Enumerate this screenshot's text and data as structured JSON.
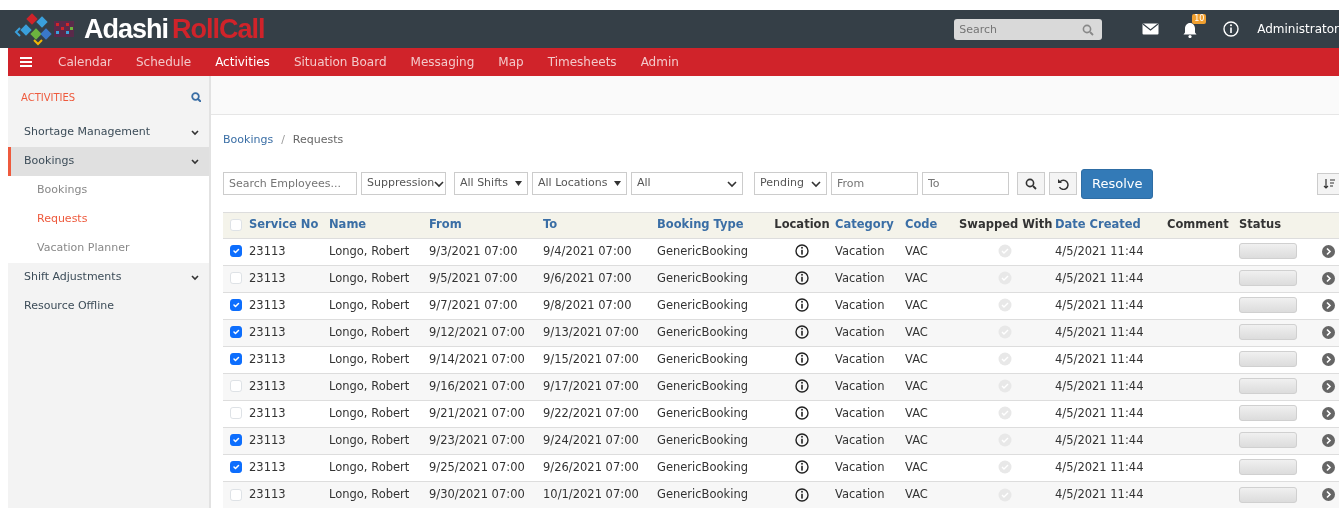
{
  "header": {
    "brand_first": "Adashi",
    "brand_second": "RollCall",
    "search": {
      "placeholder": "Search"
    },
    "notification_count": "10",
    "user": "Administrator"
  },
  "nav": [
    {
      "label": "Calendar",
      "selected": false
    },
    {
      "label": "Schedule",
      "selected": false
    },
    {
      "label": "Activities",
      "selected": true
    },
    {
      "label": "Situation Board",
      "selected": false
    },
    {
      "label": "Messaging",
      "selected": false
    },
    {
      "label": "Map",
      "selected": false
    },
    {
      "label": "Timesheets",
      "selected": false
    },
    {
      "label": "Admin",
      "selected": false
    }
  ],
  "sidebar": {
    "title": "ACTIVITIES",
    "items": [
      {
        "label": "Shortage Management",
        "selected": false,
        "kind": "group"
      },
      {
        "label": "Bookings",
        "selected": true,
        "kind": "group",
        "expanded": true,
        "children": [
          {
            "label": "Bookings",
            "selected": false
          },
          {
            "label": "Requests",
            "selected": true
          },
          {
            "label": "Vacation Planner",
            "selected": false
          }
        ]
      },
      {
        "label": "Shift Adjustments",
        "selected": false,
        "kind": "group"
      },
      {
        "label": "Resource Offline",
        "selected": false,
        "kind": "link"
      }
    ]
  },
  "breadcrumb": {
    "separator": "/",
    "items": [
      {
        "label": "Bookings",
        "kind": "link"
      },
      {
        "label": "Requests",
        "kind": "current"
      }
    ]
  },
  "filters": {
    "employee_search": {
      "placeholder": "Search Employees..."
    },
    "selects": [
      {
        "value": "Suppression",
        "kind": "chevron"
      },
      {
        "value": "All Shifts",
        "kind": "triangle"
      },
      {
        "value": "All Locations",
        "kind": "triangle"
      },
      {
        "value": "All",
        "kind": "chevron"
      },
      {
        "value": "Pending",
        "kind": "chevron"
      }
    ],
    "from": {
      "placeholder": "From"
    },
    "to": {
      "placeholder": "To"
    },
    "resolve_button": "Resolve"
  },
  "table": {
    "select_all": false,
    "columns": [
      {
        "label": "Service No",
        "sortable": true
      },
      {
        "label": "Name",
        "sortable": true
      },
      {
        "label": "From",
        "sortable": true
      },
      {
        "label": "To",
        "sortable": true
      },
      {
        "label": "Booking Type",
        "sortable": true
      },
      {
        "label": "Location",
        "sortable": false
      },
      {
        "label": "Category",
        "sortable": true
      },
      {
        "label": "Code",
        "sortable": true
      },
      {
        "label": "Swapped With",
        "sortable": false
      },
      {
        "label": "Date Created",
        "sortable": true
      },
      {
        "label": "Comment",
        "sortable": false
      },
      {
        "label": "Status",
        "sortable": false
      }
    ],
    "rows": [
      {
        "checked": true,
        "service_no": "23113",
        "name": "Longo, Robert",
        "from": "9/3/2021 07:00",
        "to": "9/4/2021 07:00",
        "booking_type": "GenericBooking",
        "category": "Vacation",
        "code": "VAC",
        "date_created": "4/5/2021 11:44"
      },
      {
        "checked": false,
        "service_no": "23113",
        "name": "Longo, Robert",
        "from": "9/5/2021 07:00",
        "to": "9/6/2021 07:00",
        "booking_type": "GenericBooking",
        "category": "Vacation",
        "code": "VAC",
        "date_created": "4/5/2021 11:44"
      },
      {
        "checked": true,
        "service_no": "23113",
        "name": "Longo, Robert",
        "from": "9/7/2021 07:00",
        "to": "9/8/2021 07:00",
        "booking_type": "GenericBooking",
        "category": "Vacation",
        "code": "VAC",
        "date_created": "4/5/2021 11:44"
      },
      {
        "checked": true,
        "service_no": "23113",
        "name": "Longo, Robert",
        "from": "9/12/2021 07:00",
        "to": "9/13/2021 07:00",
        "booking_type": "GenericBooking",
        "category": "Vacation",
        "code": "VAC",
        "date_created": "4/5/2021 11:44"
      },
      {
        "checked": true,
        "service_no": "23113",
        "name": "Longo, Robert",
        "from": "9/14/2021 07:00",
        "to": "9/15/2021 07:00",
        "booking_type": "GenericBooking",
        "category": "Vacation",
        "code": "VAC",
        "date_created": "4/5/2021 11:44"
      },
      {
        "checked": false,
        "service_no": "23113",
        "name": "Longo, Robert",
        "from": "9/16/2021 07:00",
        "to": "9/17/2021 07:00",
        "booking_type": "GenericBooking",
        "category": "Vacation",
        "code": "VAC",
        "date_created": "4/5/2021 11:44"
      },
      {
        "checked": false,
        "service_no": "23113",
        "name": "Longo, Robert",
        "from": "9/21/2021 07:00",
        "to": "9/22/2021 07:00",
        "booking_type": "GenericBooking",
        "category": "Vacation",
        "code": "VAC",
        "date_created": "4/5/2021 11:44"
      },
      {
        "checked": true,
        "service_no": "23113",
        "name": "Longo, Robert",
        "from": "9/23/2021 07:00",
        "to": "9/24/2021 07:00",
        "booking_type": "GenericBooking",
        "category": "Vacation",
        "code": "VAC",
        "date_created": "4/5/2021 11:44"
      },
      {
        "checked": true,
        "service_no": "23113",
        "name": "Longo, Robert",
        "from": "9/25/2021 07:00",
        "to": "9/26/2021 07:00",
        "booking_type": "GenericBooking",
        "category": "Vacation",
        "code": "VAC",
        "date_created": "4/5/2021 11:44"
      },
      {
        "checked": false,
        "service_no": "23113",
        "name": "Longo, Robert",
        "from": "9/30/2021 07:00",
        "to": "10/1/2021 07:00",
        "booking_type": "GenericBooking",
        "category": "Vacation",
        "code": "VAC",
        "date_created": "4/5/2021 11:44"
      }
    ]
  }
}
